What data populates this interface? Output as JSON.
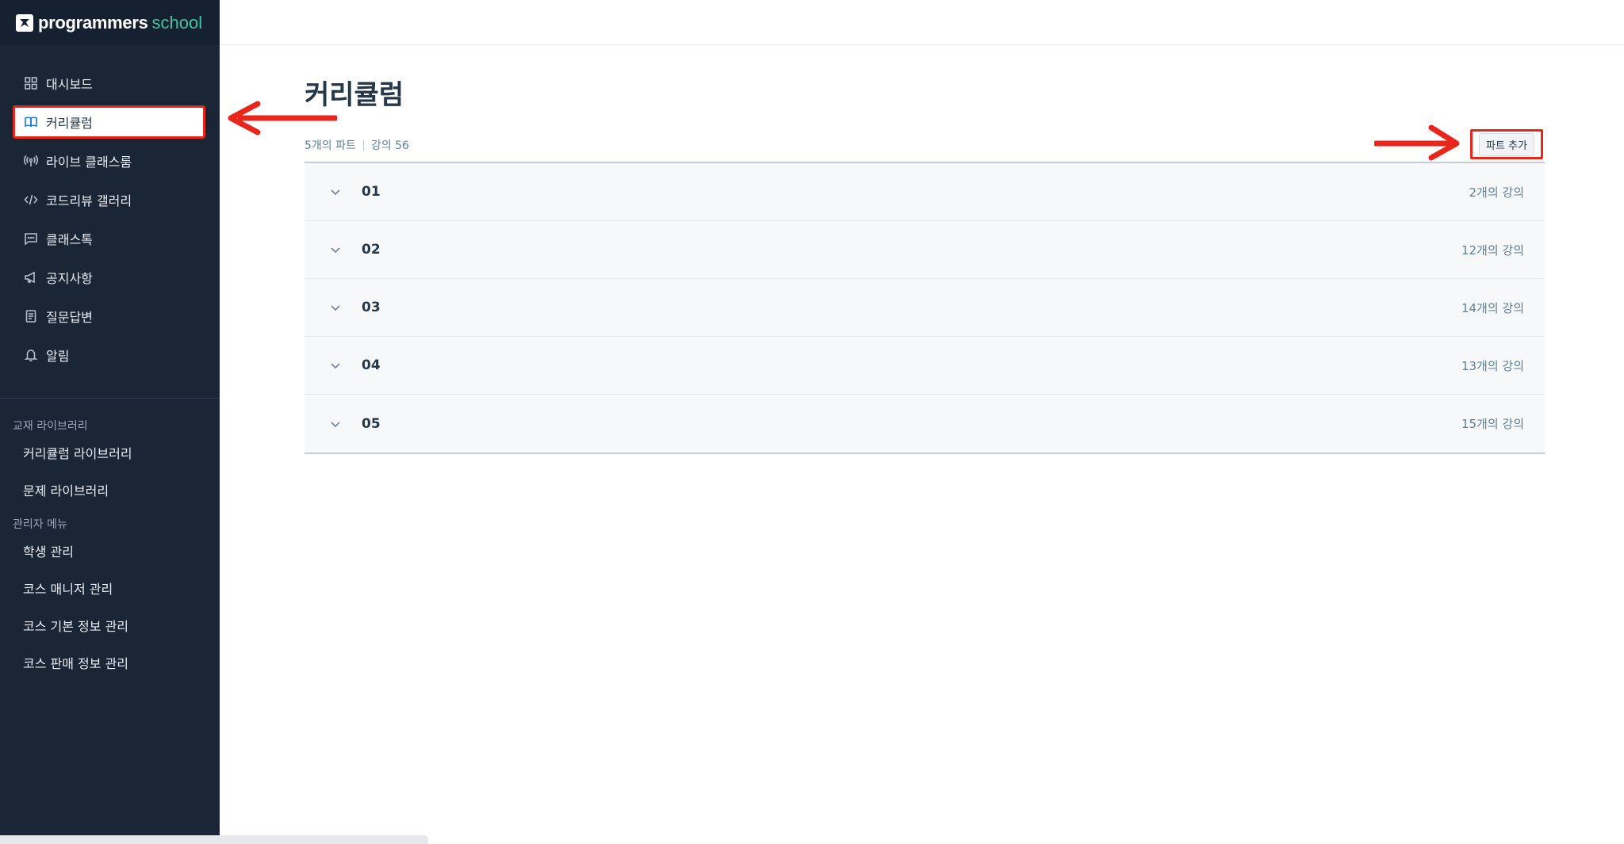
{
  "brand": {
    "name": "programmers",
    "suffix": "school"
  },
  "sidebar": {
    "items": [
      {
        "label": "대시보드",
        "icon": "dashboard-icon"
      },
      {
        "label": "커리큘럼",
        "icon": "book-icon",
        "active": true
      },
      {
        "label": "라이브 클래스룸",
        "icon": "broadcast-icon"
      },
      {
        "label": "코드리뷰 갤러리",
        "icon": "code-icon"
      },
      {
        "label": "클래스톡",
        "icon": "chat-icon"
      },
      {
        "label": "공지사항",
        "icon": "megaphone-icon"
      },
      {
        "label": "질문답변",
        "icon": "document-icon"
      },
      {
        "label": "알림",
        "icon": "bell-icon"
      }
    ],
    "library": {
      "title": "교재 라이브러리",
      "items": [
        "커리큘럼 라이브러리",
        "문제 라이브러리"
      ]
    },
    "admin": {
      "title": "관리자 메뉴",
      "items": [
        "학생 관리",
        "코스 매니저 관리",
        "코스 기본 정보 관리",
        "코스 판매 정보 관리"
      ]
    }
  },
  "main": {
    "title": "커리큘럼",
    "parts_count": "5개의 파트",
    "lectures_total": "강의 56",
    "add_part_label": "파트 추가",
    "parts": [
      {
        "number": "01",
        "count": "2개의 강의"
      },
      {
        "number": "02",
        "count": "12개의 강의"
      },
      {
        "number": "03",
        "count": "14개의 강의"
      },
      {
        "number": "04",
        "count": "13개의 강의"
      },
      {
        "number": "05",
        "count": "15개의 강의"
      }
    ]
  },
  "colors": {
    "sidebar_bg": "#1a2536",
    "accent": "#44c4a1",
    "annotation": "#e8261b"
  }
}
